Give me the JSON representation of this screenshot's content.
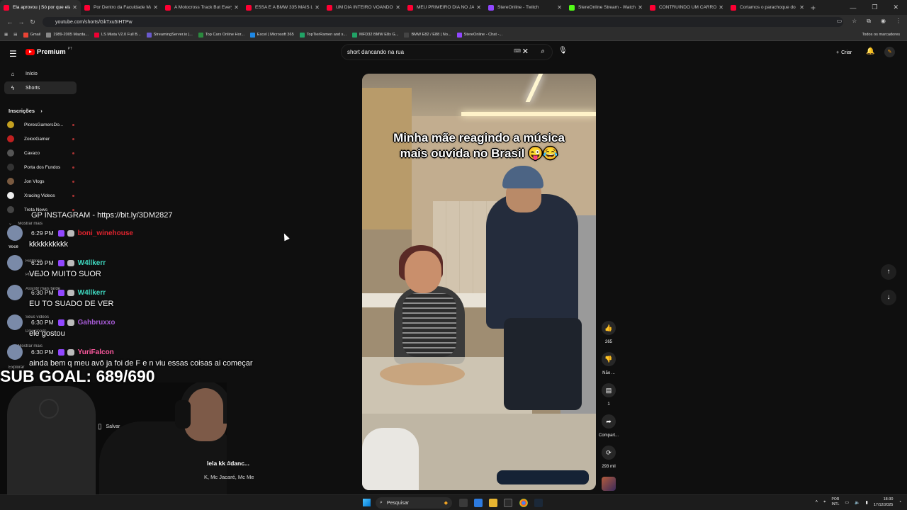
{
  "tabs": [
    {
      "title": "Ela aprovou | Só por que ela",
      "fav": "#ff0033",
      "active": true
    },
    {
      "title": "Por Dentro da Faculdade Mais",
      "fav": "#ff0033"
    },
    {
      "title": "A Motocross Track But Every",
      "fav": "#ff0033"
    },
    {
      "title": "ESSA É A BMW 335 MAIS LI",
      "fav": "#ff0033"
    },
    {
      "title": "UM DIA INTEIRO VOANDO P",
      "fav": "#ff0033"
    },
    {
      "title": "MEU PRIMEIRO DIA NO JAPÃ",
      "fav": "#ff0033"
    },
    {
      "title": "StereOnline - Twitch",
      "fav": "#9147ff"
    },
    {
      "title": "StereOnline Stream - Watch L",
      "fav": "#53fc18"
    },
    {
      "title": "CONTRUINDO UM CARRO B",
      "fav": "#ff0033"
    },
    {
      "title": "Cortamos o parachoque do 2",
      "fav": "#ff0033"
    }
  ],
  "url": "youtube.com/shorts/GkTxu5IHTPw",
  "bookmarks": [
    {
      "label": "Gmail",
      "color": "#ea4335"
    },
    {
      "label": "1989-2005 Mazda...",
      "color": "#888"
    },
    {
      "label": "LS Miata V2.0 Full B...",
      "color": "#e03"
    },
    {
      "label": "StreamingServer.io |...",
      "color": "#6a5acd"
    },
    {
      "label": "Top Cars Online Hor...",
      "color": "#2b8a3e"
    },
    {
      "label": "Excel | Microsoft 365",
      "color": "#1e88e5"
    },
    {
      "label": "TopTierRamen and s...",
      "color": "#21a366"
    },
    {
      "label": "MFD32 BMW E8x G...",
      "color": "#21a366"
    },
    {
      "label": "BMW E82 / E88 | No...",
      "color": "#444"
    },
    {
      "label": "StereOnline - Chat -...",
      "color": "#9147ff"
    }
  ],
  "bookmarks_all": "Todos os marcadores",
  "yt": {
    "logo": "Premium",
    "logo_sup": "PT",
    "search_value": "short dancando na rua",
    "create": "Criar"
  },
  "sidebar": {
    "home": "Início",
    "shorts": "Shorts",
    "subs_header": "Inscrições",
    "subs": [
      {
        "name": "PloresGamersDo...",
        "color": "#c4a020"
      },
      {
        "name": "ZoiooGamer",
        "color": "#c02020"
      },
      {
        "name": "Cavaco",
        "color": "#555"
      },
      {
        "name": "Porta dos Fundos",
        "color": "#333"
      },
      {
        "name": "Jon Vlogs",
        "color": "#7a5a40"
      },
      {
        "name": "Xracing Videos",
        "color": "#eee"
      },
      {
        "name": "Treta News",
        "color": "#444"
      }
    ],
    "show_more": "Mostrar mais",
    "you": "Você",
    "history": "Histórico",
    "playlists": "Playlists",
    "watch_later": "Assistir mais tarde",
    "your_videos": "Seus vídeos",
    "downloads": "Downloads",
    "show_more2": "Mostrar mais",
    "explore": "Explorar"
  },
  "chat": {
    "topline": "GP INSTAGRAM - https://bit.ly/3DM2827",
    "messages": [
      {
        "time": "6:29 PM",
        "user": "boni_winehouse",
        "color": "#e0242e",
        "text": "kkkkkkkkkk"
      },
      {
        "time": "6:29 PM",
        "user": "W4llkerr",
        "color": "#3fd9c0",
        "text": "VEJO MUITO SUOR"
      },
      {
        "time": "6:30 PM",
        "user": "W4llkerr",
        "color": "#3fd9c0",
        "text": "EU TO SUADO DE VER"
      },
      {
        "time": "6:30 PM",
        "user": "Gahbruxxo",
        "color": "#a65bd6",
        "text": "ele gostou"
      },
      {
        "time": "6:30 PM",
        "user": "YuriFalcon",
        "color": "#ff5aa0",
        "text": "ainda bem q meu avô ja foi de F e n viu essas coisas ai começar"
      }
    ],
    "sub_goal": "SUB GOAL: 689/690"
  },
  "short": {
    "caption_line1": "Minha mãe reagindo a música",
    "caption_line2": "mais ouvida no Brasil 😜😂",
    "title": "lela kk #danc...",
    "tags": "K, Mc Jacaré, Mc Me",
    "save": "Salvar"
  },
  "actions": {
    "likes": "265",
    "dislike": "Não ...",
    "comments": "1",
    "share": "Compart...",
    "remix": "293 mil"
  },
  "taskbar": {
    "search": "Pesquisar",
    "lang1": "POR",
    "lang2": "INTL",
    "time": "18:30",
    "date": "17/12/2025"
  }
}
